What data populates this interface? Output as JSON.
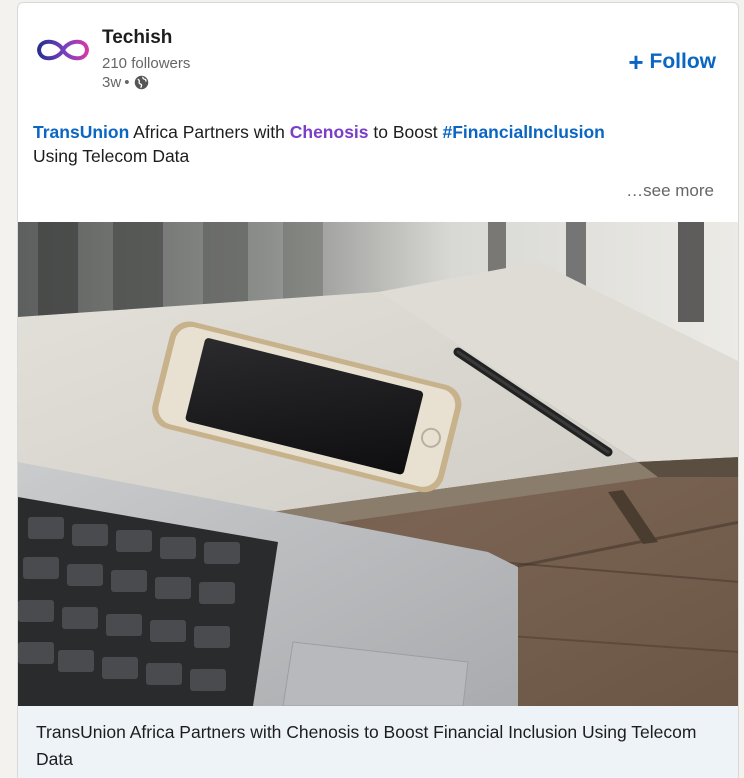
{
  "post": {
    "author": {
      "name": "Techish",
      "followers": "210 followers",
      "time": "3w",
      "separator": " • ",
      "visibility_icon": "globe-icon"
    },
    "follow_button": {
      "icon": "plus-icon",
      "label": "Follow"
    },
    "commentary": {
      "company_mention": "TransUnion",
      "text_1": " Africa Partners with ",
      "partner_mention": "Chenosis",
      "text_2": " to Boost ",
      "hashtag": "#FinancialInclusion",
      "text_3": " Using Telecom Data"
    },
    "see_more": "…see more",
    "media": {
      "description_icon": "article-image"
    },
    "article": {
      "title": "TransUnion Africa Partners with Chenosis to Boost Financial Inclusion Using Telecom Data"
    }
  },
  "colors": {
    "link_blue": "#0a66c2",
    "mention_purple": "#7a3ec9",
    "article_bg": "#eef3f8",
    "text_primary": "#1d1d1d",
    "text_secondary": "#666666"
  }
}
